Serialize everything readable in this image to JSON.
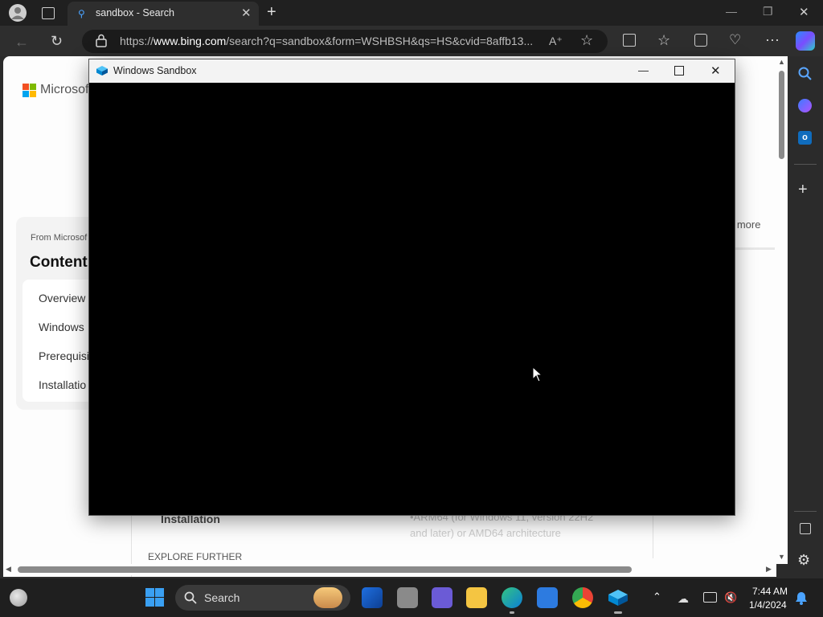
{
  "browser": {
    "tab_title": "sandbox - Search",
    "url_prefix": "https://",
    "url_host": "www.bing.com",
    "url_rest": "/search?q=sandbox&form=WSHBSH&qs=HS&cvid=8affb13..."
  },
  "page": {
    "brand": "Microsoft",
    "from_label": "From Microsof",
    "contents_heading": "Content",
    "toc": [
      "Overview",
      "Windows",
      "Prerequisi",
      "Installatio"
    ],
    "more_link": "e more",
    "installation_heading": "Installation",
    "body_line1": "•ARM64 (for Windows 11, version 22H2",
    "body_line2": "and later) or AMD64 architecture",
    "explore_label": "EXPLORE FURTHER"
  },
  "sandbox_window": {
    "title": "Windows Sandbox"
  },
  "taskbar": {
    "search_label": "Search",
    "time": "7:44 AM",
    "date": "1/4/2024"
  }
}
